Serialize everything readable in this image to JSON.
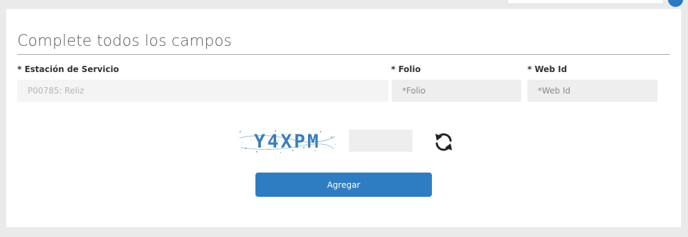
{
  "form": {
    "title": "Complete todos los campos",
    "station": {
      "label": "* Estación de Servicio",
      "value": "P00785: Reliz"
    },
    "folio": {
      "label": "* Folio",
      "placeholder": "*Folio"
    },
    "web_id": {
      "label": "* Web Id",
      "placeholder": "*Web Id"
    },
    "captcha": {
      "text": "Y4XPM",
      "input_value": ""
    },
    "submit_label": "Agregar"
  },
  "colors": {
    "accent": "#2e7dc2",
    "captcha_text": "#3b7fba"
  },
  "icons": {
    "refresh": "refresh-icon"
  }
}
